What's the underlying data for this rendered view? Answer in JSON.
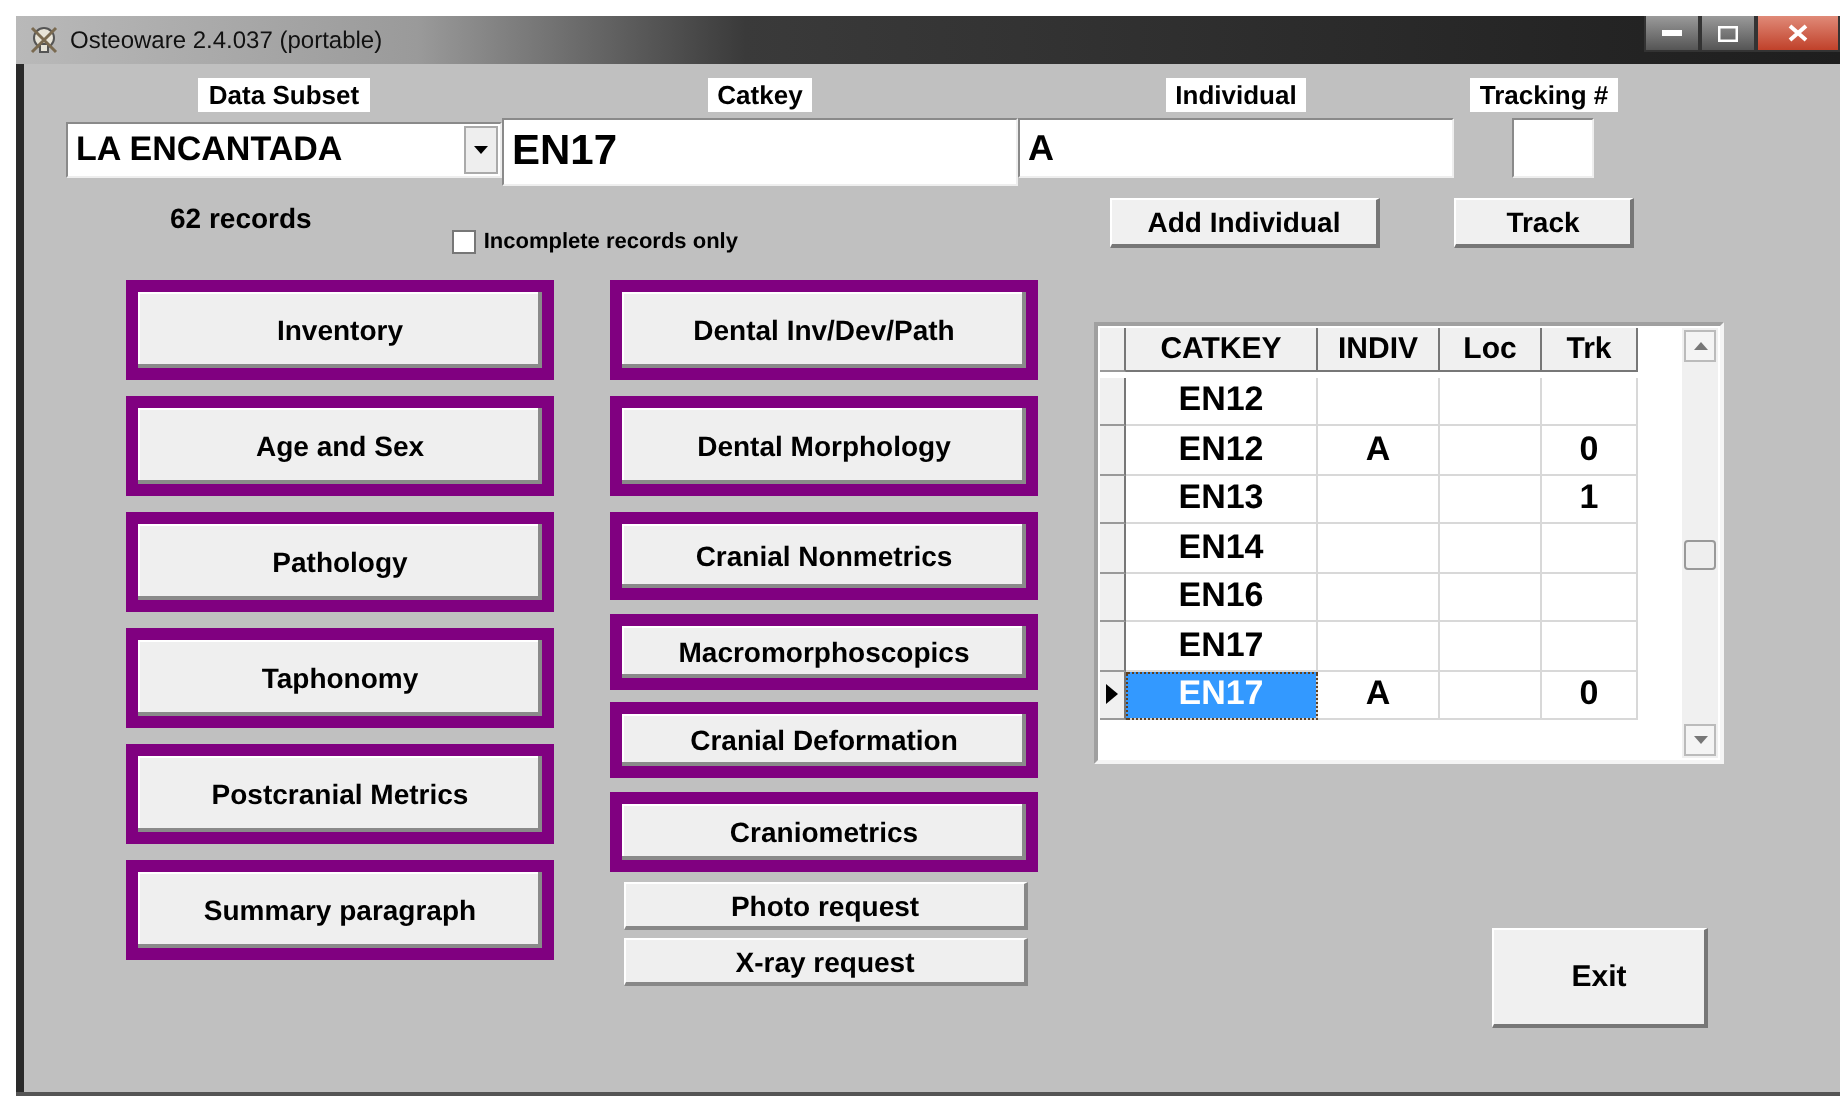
{
  "window": {
    "title": "Osteoware 2.4.037 (portable)"
  },
  "data_subset": {
    "label": "Data Subset",
    "value": "LA ENCANTADA"
  },
  "catkey": {
    "label": "Catkey",
    "value": "EN17"
  },
  "individual": {
    "label": "Individual",
    "value": "A"
  },
  "tracking": {
    "label": "Tracking #"
  },
  "record_count": "62 records",
  "incomplete_only": {
    "label": "Incomplete records only",
    "checked": false
  },
  "actions": {
    "add_individual": "Add Individual",
    "track": "Track",
    "exit": "Exit"
  },
  "left_buttons": [
    {
      "label": "Inventory",
      "kind": "framed"
    },
    {
      "label": "Age and Sex",
      "kind": "framed"
    },
    {
      "label": "Pathology",
      "kind": "framed"
    },
    {
      "label": "Taphonomy",
      "kind": "framed"
    },
    {
      "label": "Postcranial Metrics",
      "kind": "framed"
    },
    {
      "label": "Summary paragraph",
      "kind": "framed"
    }
  ],
  "middle_buttons": [
    {
      "label": "Dental Inv/Dev/Path",
      "kind": "framed"
    },
    {
      "label": "Dental Morphology",
      "kind": "framed"
    },
    {
      "label": "Cranial Nonmetrics",
      "kind": "framed"
    },
    {
      "label": "Macromorphoscopics",
      "kind": "framed"
    },
    {
      "label": "Cranial Deformation",
      "kind": "framed"
    },
    {
      "label": "Craniometrics",
      "kind": "framed"
    },
    {
      "label": "Photo request",
      "kind": "plain"
    },
    {
      "label": "X-ray request",
      "kind": "plain"
    }
  ],
  "table": {
    "columns": [
      "CATKEY",
      "INDIV",
      "Loc",
      "Trk"
    ],
    "rows": [
      {
        "catkey": "EN12",
        "selected": false
      },
      {
        "catkey": "EN12",
        "indiv": "A",
        "trk": "0",
        "selected": false
      },
      {
        "catkey": "EN13",
        "trk": "1",
        "selected": false
      },
      {
        "catkey": "EN14",
        "selected": false
      },
      {
        "catkey": "EN16",
        "selected": false
      },
      {
        "catkey": "EN17",
        "selected": false
      },
      {
        "catkey": "EN17",
        "indiv": "A",
        "trk": "0",
        "selected": true
      }
    ]
  }
}
